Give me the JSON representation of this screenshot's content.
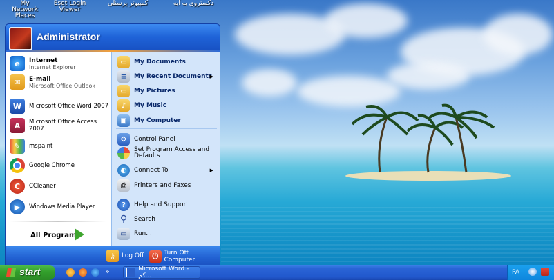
{
  "desktop": {
    "icons": [
      {
        "line1": "My Network",
        "line2": "Places"
      },
      {
        "line1": "Eset Login",
        "line2": "Viewer"
      },
      {
        "line1": "کمپیوتر پرسنلی",
        "line2": ""
      },
      {
        "line1": "دکستروی به آیه",
        "line2": ""
      }
    ]
  },
  "start_menu": {
    "username": "Administrator",
    "pinned": [
      {
        "title": "Internet",
        "subtitle": "Internet Explorer",
        "icon": "internet-explorer-icon"
      },
      {
        "title": "E-mail",
        "subtitle": "Microsoft Office Outlook",
        "icon": "outlook-icon"
      }
    ],
    "recent": [
      {
        "label": "Microsoft Office Word 2007",
        "icon": "word-icon"
      },
      {
        "label": "Microsoft Office Access 2007",
        "icon": "access-icon"
      },
      {
        "label": "mspaint",
        "icon": "paint-icon"
      },
      {
        "label": "Google Chrome",
        "icon": "chrome-icon"
      },
      {
        "label": "CCleaner",
        "icon": "ccleaner-icon"
      },
      {
        "label": "Windows Media Player",
        "icon": "media-player-icon"
      }
    ],
    "all_programs": "All Programs",
    "places": [
      {
        "label": "My Documents",
        "icon": "documents-folder-icon",
        "submenu": false
      },
      {
        "label": "My Recent Documents",
        "icon": "recent-documents-icon",
        "submenu": true
      },
      {
        "label": "My Pictures",
        "icon": "pictures-folder-icon",
        "submenu": false
      },
      {
        "label": "My Music",
        "icon": "music-folder-icon",
        "submenu": false
      },
      {
        "label": "My Computer",
        "icon": "computer-icon",
        "submenu": false
      }
    ],
    "settings": [
      {
        "label": "Control Panel",
        "icon": "control-panel-icon",
        "submenu": false
      },
      {
        "label": "Set Program Access and Defaults",
        "icon": "program-access-icon",
        "submenu": false
      },
      {
        "label": "Connect To",
        "icon": "connect-to-icon",
        "submenu": true
      },
      {
        "label": "Printers and Faxes",
        "icon": "printer-icon",
        "submenu": false
      }
    ],
    "help": [
      {
        "label": "Help and Support",
        "icon": "help-icon"
      },
      {
        "label": "Search",
        "icon": "search-icon"
      },
      {
        "label": "Run...",
        "icon": "run-icon"
      }
    ],
    "log_off": "Log Off",
    "turn_off": "Turn Off Computer"
  },
  "taskbar": {
    "start_label": "start",
    "task_label": "Microsoft Word - کم...",
    "tray_language": "PA",
    "chevron": "»"
  },
  "colors": {
    "menu_blue": "#1f57c8",
    "places_pane": "#d3e5fa",
    "start_green": "#33a02c"
  }
}
